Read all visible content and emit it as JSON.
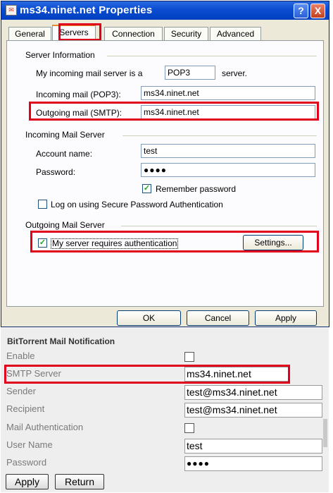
{
  "dialog": {
    "title": "ms34.ninet.net Properties",
    "help_glyph": "?",
    "close_glyph": "X",
    "tabs": [
      "General",
      "Servers",
      "Connection",
      "Security",
      "Advanced"
    ],
    "server_info": {
      "group_label": "Server Information",
      "my_incoming_prefix": "My incoming mail server is a",
      "server_type": "POP3",
      "my_incoming_suffix": "server.",
      "incoming_label": "Incoming mail (POP3):",
      "incoming_value": "ms34.ninet.net",
      "outgoing_label": "Outgoing mail (SMTP):",
      "outgoing_value": "ms34.ninet.net"
    },
    "incoming_server": {
      "group_label": "Incoming Mail Server",
      "account_label": "Account name:",
      "account_value": "test",
      "password_label": "Password:",
      "password_value": "●●●●",
      "remember_label": "Remember password",
      "remember_checked": true,
      "spa_label": "Log on using Secure Password Authentication",
      "spa_checked": false
    },
    "outgoing_server": {
      "group_label": "Outgoing Mail Server",
      "auth_label": "My server requires authentication",
      "auth_checked": true,
      "settings_label": "Settings..."
    },
    "buttons": {
      "ok": "OK",
      "cancel": "Cancel",
      "apply": "Apply"
    },
    "check_glyph": "✓"
  },
  "bittorrent": {
    "header": "BitTorrent Mail Notification",
    "enable_label": "Enable",
    "smtp_label": "SMTP Server",
    "smtp_value": "ms34.ninet.net",
    "sender_label": "Sender",
    "sender_value": "test@ms34.ninet.net",
    "recipient_label": "Recipient",
    "recipient_value": "test@ms34.ninet.net",
    "auth_label": "Mail Authentication",
    "username_label": "User Name",
    "username_value": "test",
    "password_label": "Password",
    "password_value": "●●●●",
    "apply_label": "Apply",
    "return_label": "Return"
  },
  "colors": {
    "highlight_red": "#e0001b",
    "xp_title_blue": "#0a4bd0",
    "dialog_face": "#ece9d8"
  }
}
